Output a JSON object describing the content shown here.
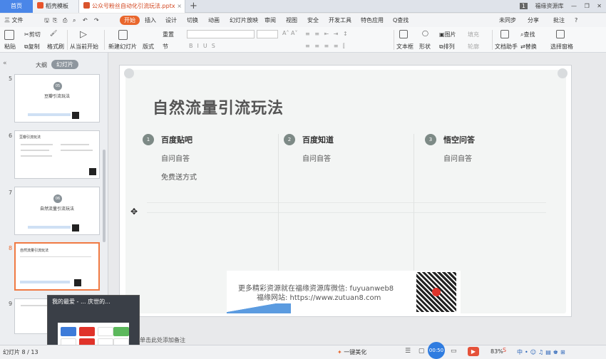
{
  "tabs": {
    "home": "首页",
    "template": "稻壳模板",
    "doc": "公众号粉丝自动化引流玩法.pptx",
    "new_tab": "+"
  },
  "topright": {
    "badge": "1",
    "account": "福缘资源库"
  },
  "menu": {
    "file": "三 文件",
    "items": [
      "开始",
      "插入",
      "设计",
      "切换",
      "动画",
      "幻灯片放映",
      "审阅",
      "视图",
      "安全",
      "开发工具",
      "特色应用",
      "Q查找"
    ],
    "right": [
      "未同步",
      "分享",
      "批注",
      "?"
    ]
  },
  "ribbon": {
    "paste": "粘贴",
    "cut": "剪切",
    "copy": "复制",
    "format_painter": "格式刷",
    "from_start": "从当前开始",
    "new_slide": "新建幻灯片",
    "layout": "版式",
    "reset": "重置",
    "section": "节",
    "textbox": "文本框",
    "shape": "形状",
    "picture": "图片",
    "arrange": "排列",
    "fill": "填充",
    "outline": "轮廓",
    "doc_helper": "文档助手",
    "find": "查找",
    "replace": "替换",
    "select_pane": "选择窗格",
    "bold": "B",
    "italic": "I",
    "underline": "U",
    "strike": "S"
  },
  "leftpane": {
    "outline": "大纲",
    "slides": "幻灯片",
    "thumbs": [
      {
        "num": "5",
        "title": "豆瓣引流玩法",
        "circle": "05"
      },
      {
        "num": "6",
        "title": "豆瓣引流玩法",
        "circle": ""
      },
      {
        "num": "7",
        "title": "自然流量引流玩法",
        "circle": "06"
      },
      {
        "num": "8",
        "title": "自然流量引流玩法",
        "circle": ""
      },
      {
        "num": "9",
        "title": "",
        "circle": ""
      }
    ]
  },
  "slide": {
    "title": "自然流量引流玩法",
    "columns": [
      {
        "num": "1",
        "heading": "百度贴吧",
        "items": [
          "自问自答",
          "免费送方式"
        ]
      },
      {
        "num": "2",
        "heading": "百度知道",
        "items": [
          "自问自答"
        ]
      },
      {
        "num": "3",
        "heading": "悟空问答",
        "items": [
          "自问自答"
        ]
      }
    ]
  },
  "watermark": {
    "line1": "更多精彩资源就在福缘资源库微信: fuyuanweb8",
    "line2": "福缘网站: https://www.zutuan8.com"
  },
  "popup": {
    "title": "我的最爱 - ... 庆世的..."
  },
  "status": {
    "slide_count": "幻灯片 8 / 13",
    "notes": "单击此处添加备注",
    "beautify": "一键美化",
    "timer": "00:50",
    "zoom": "83%"
  },
  "colors": {
    "accent": "#e9662c",
    "home_tab": "#4a86e8",
    "selected_thumb": "#f07a43",
    "circle": "#7d8a86"
  }
}
